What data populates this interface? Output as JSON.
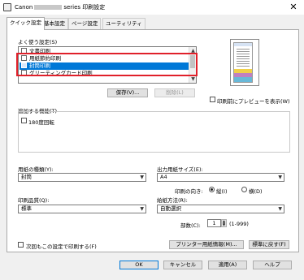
{
  "window": {
    "title_prefix": "Canon",
    "title_suffix": "series 印刷設定",
    "close_glyph": "✕"
  },
  "tabs": [
    {
      "label": "クイック設定",
      "active": true
    },
    {
      "label": "基本設定",
      "active": false
    },
    {
      "label": "ページ設定",
      "active": false
    },
    {
      "label": "ユーティリティ",
      "active": false
    }
  ],
  "favorites": {
    "label": "よく使う設定(S)",
    "items": [
      {
        "label": "文書印刷",
        "icon": "document-icon",
        "selected": false
      },
      {
        "label": "用紙節約印刷",
        "icon": "paper-save-icon",
        "selected": false
      },
      {
        "label": "封筒印刷",
        "icon": "envelope-icon",
        "selected": true
      },
      {
        "label": "グリーティングカード印刷",
        "icon": "card-icon",
        "selected": false
      }
    ],
    "save_button": "保存(V)...",
    "delete_button": "削除(L)"
  },
  "preview": {
    "checkbox_label": "印刷前にプレビューを表示(W)",
    "checked": false
  },
  "features": {
    "label": "追加する機能(T)",
    "rotate_180": "180度回転",
    "rotate_180_checked": false
  },
  "media_type": {
    "label": "用紙の種類(Y):",
    "value": "封筒"
  },
  "page_size": {
    "label": "出力用紙サイズ(E):",
    "value": "A4"
  },
  "orientation": {
    "label": "印刷の向き:",
    "portrait": "縦(I)",
    "landscape": "横(D)",
    "selected": "portrait"
  },
  "quality": {
    "label": "印刷品質(Q):",
    "value": "標準"
  },
  "paper_source": {
    "label": "給紙方法(R):",
    "value": "自動選択"
  },
  "copies": {
    "label": "部数(C):",
    "value": "1",
    "range": "(1-999)"
  },
  "always_print": {
    "label": "次回もこの設定で印刷する(F)",
    "checked": false
  },
  "printer_media_info_button": "プリンター用紙情報(M)...",
  "defaults_button": "標準に戻す(F)",
  "footer": {
    "ok": "OK",
    "cancel": "キャンセル",
    "apply": "適用(A)",
    "help": "ヘルプ"
  }
}
